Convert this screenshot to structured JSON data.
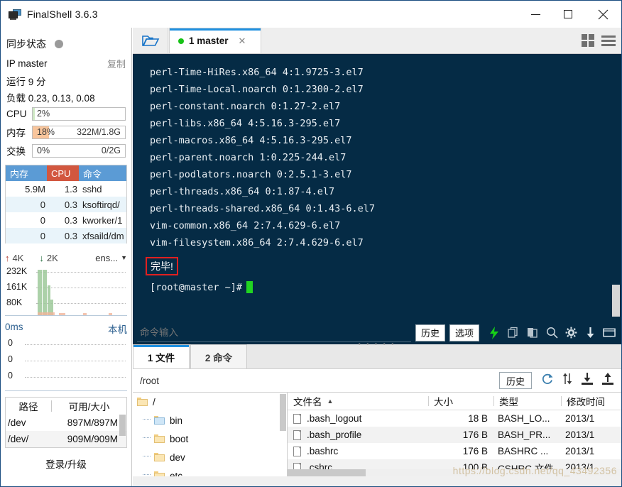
{
  "window": {
    "title": "FinalShell 3.6.3",
    "icon": "monitor-icon",
    "minimize": "–",
    "maximize": "□",
    "close": "✕"
  },
  "sidebar": {
    "sync": {
      "label": "同步状态",
      "status_icon": "gray-dot"
    },
    "ip": {
      "label": "IP master",
      "copy": "复制"
    },
    "uptime": "运行 9 分",
    "load": "负载 0.23, 0.13, 0.08",
    "meters": [
      {
        "name": "CPU",
        "label": "CPU",
        "percent": "2%",
        "extra": "",
        "fill_pct": 2,
        "color": "#cfe9c5"
      },
      {
        "name": "memory",
        "label": "内存",
        "percent": "18%",
        "extra": "322M/1.8G",
        "fill_pct": 18,
        "color": "#f8c59c"
      },
      {
        "name": "swap",
        "label": "交换",
        "percent": "0%",
        "extra": "0/2G",
        "fill_pct": 0,
        "color": "#cfe9c5"
      }
    ],
    "processes": {
      "headers": [
        "内存",
        "CPU",
        "命令"
      ],
      "header_colors": [
        "#5b9bd5",
        "#d2573f",
        "#5b9bd5"
      ],
      "rows": [
        {
          "mem": "5.9M",
          "cpu": "1.3",
          "cmd": "sshd",
          "mem_bar": "#f2b98e",
          "cpu_bar": "#9ec99a"
        },
        {
          "mem": "0",
          "cpu": "0.3",
          "cmd": "ksoftirqd/",
          "mem_bar": "",
          "cpu_bar": "#9ec99a"
        },
        {
          "mem": "0",
          "cpu": "0.3",
          "cmd": "kworker/1",
          "mem_bar": "",
          "cpu_bar": "#9ec99a"
        },
        {
          "mem": "0",
          "cpu": "0.3",
          "cmd": "xfsaild/dm",
          "mem_bar": "",
          "cpu_bar": "#9ec99a"
        }
      ]
    },
    "network": {
      "up_arrow": "↑",
      "up_value": "4K",
      "down_arrow": "↓",
      "down_value": "2K",
      "interface": "ens...",
      "caret": "▼",
      "y_labels": [
        "232K",
        "161K",
        "80K"
      ]
    },
    "ping": {
      "latency": "0ms",
      "host": "本机",
      "y_labels": [
        "0",
        "0",
        "0"
      ]
    },
    "disks": {
      "headers": [
        "路径",
        "可用/大小"
      ],
      "rows": [
        {
          "path": "/dev",
          "value": "897M/897M"
        },
        {
          "path": "/dev/",
          "value": "909M/909M"
        }
      ]
    },
    "login_link": "登录/升级"
  },
  "tabstrip": {
    "folder_icon": "open-folder-icon",
    "tabs": [
      {
        "label": "1 master",
        "status": "connected",
        "close": "✕"
      }
    ],
    "grid_icon": "grid-view-icon",
    "list_icon": "list-view-icon"
  },
  "terminal": {
    "lines": [
      "perl-Time-HiRes.x86_64 4:1.9725-3.el7",
      "perl-Time-Local.noarch 0:1.2300-2.el7",
      "perl-constant.noarch 0:1.27-2.el7",
      "perl-libs.x86_64 4:5.16.3-295.el7",
      "perl-macros.x86_64 4:5.16.3-295.el7",
      "perl-parent.noarch 1:0.225-244.el7",
      "perl-podlators.noarch 0:2.5.1-3.el7",
      "perl-threads.x86_64 0:1.87-4.el7",
      "perl-threads-shared.x86_64 0:1.43-6.el7",
      "vim-common.x86_64 2:7.4.629-6.el7",
      "vim-filesystem.x86_64 2:7.4.629-6.el7"
    ],
    "highlight": "完毕!",
    "highlight_color": "#e02020",
    "prompt": "[root@master ~]#",
    "cursor_color": "#21d421",
    "bg_color": "#052b45"
  },
  "command_bar": {
    "placeholder": "命令输入",
    "history_label": "历史",
    "options_label": "选项",
    "icons": [
      "lightning-icon",
      "copy-icon",
      "paste-icon",
      "search-icon",
      "gear-icon",
      "download-arrow-icon",
      "window-icon"
    ]
  },
  "bottom_tabs": [
    {
      "label": "1 文件",
      "active": true
    },
    {
      "label": "2 命令",
      "active": false
    }
  ],
  "path_bar": {
    "path": "/root",
    "history_label": "历史",
    "icons": [
      "refresh-icon",
      "transfer-icon",
      "download-icon",
      "upload-icon"
    ]
  },
  "tree": {
    "items": [
      {
        "label": "/",
        "depth": 0,
        "icon": "folder-icon"
      },
      {
        "label": "bin",
        "depth": 1,
        "icon": "folder-blue-icon"
      },
      {
        "label": "boot",
        "depth": 1,
        "icon": "folder-icon"
      },
      {
        "label": "dev",
        "depth": 1,
        "icon": "folder-icon"
      },
      {
        "label": "etc",
        "depth": 1,
        "icon": "folder-icon"
      }
    ]
  },
  "file_list": {
    "headers": [
      "文件名",
      "大小",
      "类型",
      "修改时间"
    ],
    "sort_caret": "▲",
    "rows": [
      {
        "name": ".bash_logout",
        "size": "18 B",
        "type": "BASH_LO...",
        "mtime": "2013/1"
      },
      {
        "name": ".bash_profile",
        "size": "176 B",
        "type": "BASH_PR...",
        "mtime": "2013/1"
      },
      {
        "name": ".bashrc",
        "size": "176 B",
        "type": "BASHRC ...",
        "mtime": "2013/1"
      },
      {
        "name": ".cshrc",
        "size": "100 B",
        "type": "CSHRC 文件",
        "mtime": "2013/1"
      }
    ]
  },
  "watermark": "https://blog.csdn.net/qq_43492356"
}
